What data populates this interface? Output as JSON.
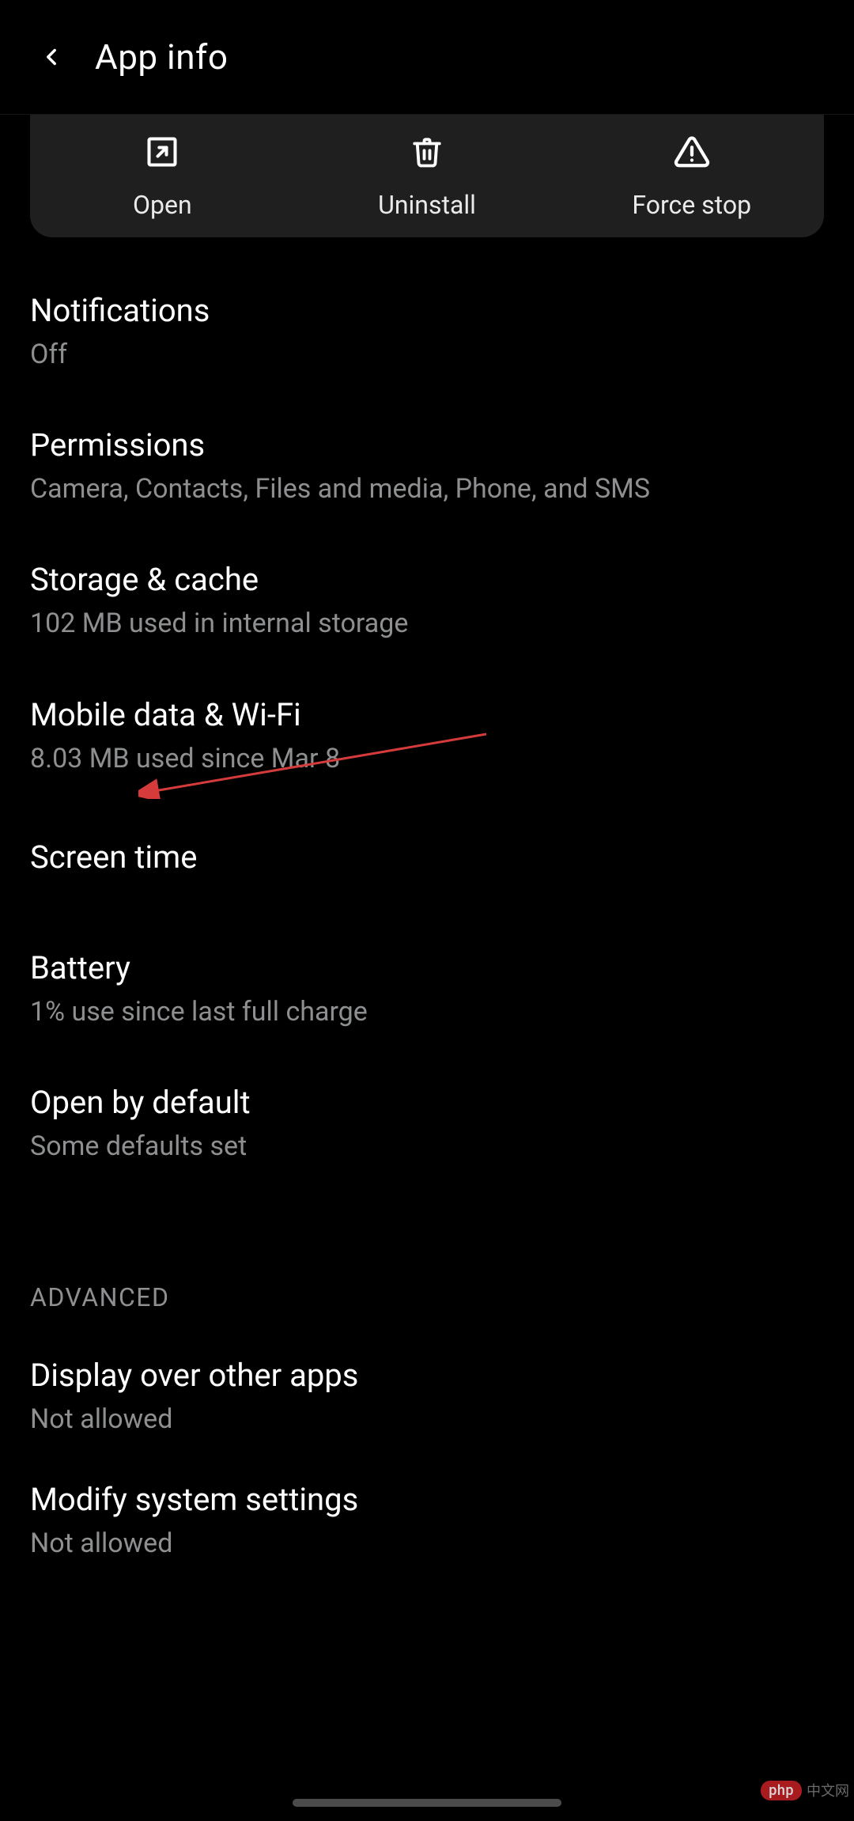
{
  "header": {
    "title": "App info"
  },
  "actions": {
    "open_label": "Open",
    "uninstall_label": "Uninstall",
    "forcestop_label": "Force stop"
  },
  "items": {
    "notifications": {
      "title": "Notifications",
      "sub": "Off"
    },
    "permissions": {
      "title": "Permissions",
      "sub": "Camera, Contacts, Files and media, Phone, and SMS"
    },
    "storage": {
      "title": "Storage & cache",
      "sub": "102 MB used in internal storage"
    },
    "mobiledata": {
      "title": "Mobile data & Wi-Fi",
      "sub": "8.03 MB used since Mar 8"
    },
    "screentime": {
      "title": "Screen time"
    },
    "battery": {
      "title": "Battery",
      "sub": "1% use since last full charge"
    },
    "openbydefault": {
      "title": "Open by default",
      "sub": "Some defaults set"
    }
  },
  "advanced": {
    "header": "ADVANCED",
    "displayover": {
      "title": "Display over other apps",
      "sub": "Not allowed"
    },
    "modifysys": {
      "title": "Modify system settings",
      "sub": "Not allowed"
    }
  },
  "watermark": {
    "pill": "php",
    "text": "中文网"
  },
  "annotation": {
    "color": "#d63b3b"
  }
}
